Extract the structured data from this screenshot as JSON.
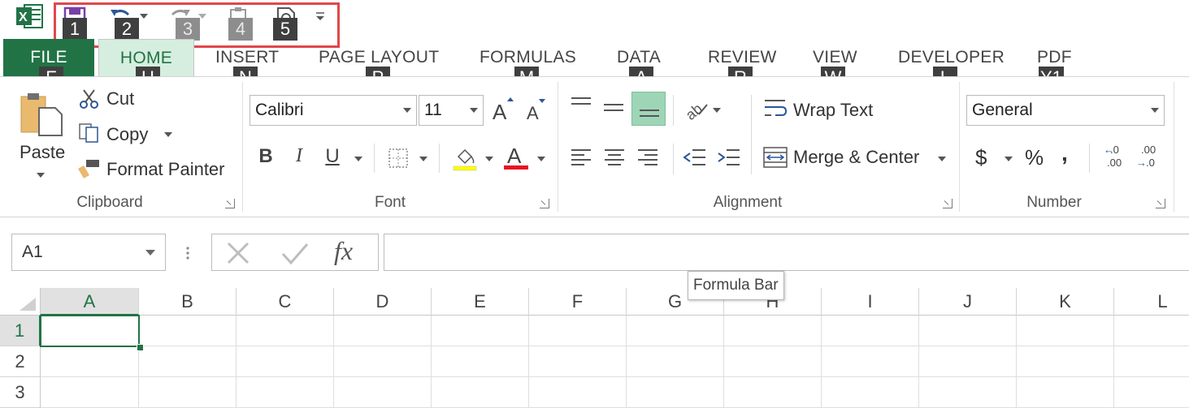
{
  "colors": {
    "accent": "#217346",
    "highlight_box": "#e0474c",
    "keytip_bg": "#3f3f3f"
  },
  "quick_access": {
    "keytips": [
      "1",
      "2",
      "3",
      "4",
      "5"
    ],
    "items": [
      "save-icon",
      "undo-icon",
      "redo-icon",
      "touch-mode-icon",
      "print-preview-icon"
    ]
  },
  "tabs": [
    {
      "label": "FILE",
      "keytip": "F"
    },
    {
      "label": "HOME",
      "keytip": "H"
    },
    {
      "label": "INSERT",
      "keytip": "N"
    },
    {
      "label": "PAGE LAYOUT",
      "keytip": "P"
    },
    {
      "label": "FORMULAS",
      "keytip": "M"
    },
    {
      "label": "DATA",
      "keytip": "A"
    },
    {
      "label": "REVIEW",
      "keytip": "R"
    },
    {
      "label": "VIEW",
      "keytip": "W"
    },
    {
      "label": "DEVELOPER",
      "keytip": "L"
    },
    {
      "label": "PDF",
      "keytip": "Y1"
    }
  ],
  "clipboard": {
    "paste_label": "Paste",
    "cut_label": "Cut",
    "copy_label": "Copy",
    "format_painter_label": "Format Painter",
    "group_label": "Clipboard"
  },
  "font": {
    "font_name": "Calibri",
    "font_size": "11",
    "bold": "B",
    "italic": "I",
    "underline": "U",
    "group_label": "Font"
  },
  "alignment": {
    "wrap_text_label": "Wrap Text",
    "merge_center_label": "Merge & Center",
    "group_label": "Alignment"
  },
  "number": {
    "format_value": "General",
    "currency_symbol": "$",
    "percent_symbol": "%",
    "comma_symbol": ",",
    "increase_decimal": ".0",
    "decrease_decimal": ".00",
    "group_label": "Number"
  },
  "formula_bar": {
    "name_box_value": "A1",
    "fx_label": "fx",
    "tooltip": "Formula Bar"
  },
  "grid": {
    "columns": [
      "A",
      "B",
      "C",
      "D",
      "E",
      "F",
      "G",
      "H",
      "I",
      "J",
      "K",
      "L"
    ],
    "rows": [
      "1",
      "2",
      "3"
    ]
  }
}
